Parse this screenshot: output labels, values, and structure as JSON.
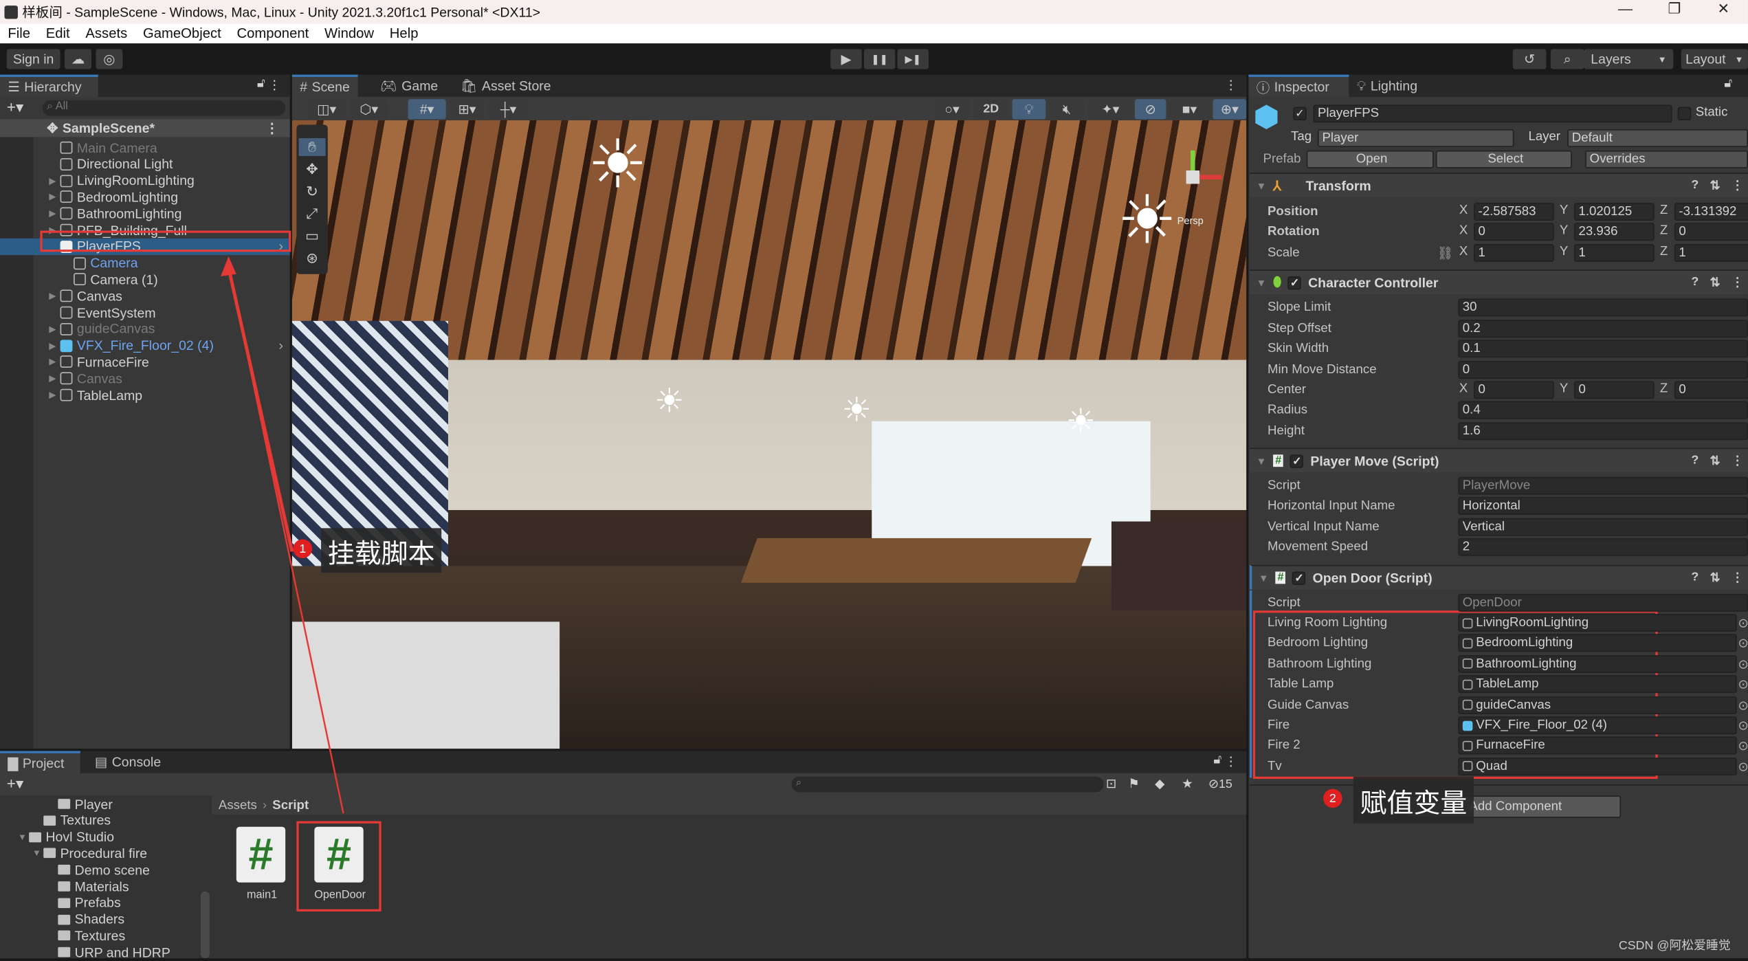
{
  "window": {
    "title": "样板间 - SampleScene - Windows, Mac, Linux - Unity 2021.3.20f1c1 Personal* <DX11>",
    "controls": [
      "—",
      "❐",
      "✕"
    ]
  },
  "menu": [
    "File",
    "Edit",
    "Assets",
    "GameObject",
    "Component",
    "Window",
    "Help"
  ],
  "toolbar": {
    "sign_in": "Sign in",
    "play": "▶",
    "pause": "❚❚",
    "step": "▶❚",
    "layers": "Layers",
    "layout": "Layout"
  },
  "hierarchy": {
    "tab": "Hierarchy",
    "search_placeholder": "All",
    "scene": "SampleScene*",
    "items": [
      {
        "label": "Main Camera",
        "state": "disabled"
      },
      {
        "label": "Directional Light"
      },
      {
        "label": "LivingRoomLighting",
        "expandable": true
      },
      {
        "label": "BedroomLighting",
        "expandable": true
      },
      {
        "label": "BathroomLighting",
        "expandable": true
      },
      {
        "label": "PFB_Building_Full",
        "expandable": true
      },
      {
        "label": "PlayerFPS",
        "selected": true,
        "prefab": true
      },
      {
        "label": "Camera",
        "child": true,
        "color": "blue"
      },
      {
        "label": "Camera (1)",
        "child": true
      },
      {
        "label": "Canvas",
        "expandable": true
      },
      {
        "label": "EventSystem"
      },
      {
        "label": "guideCanvas",
        "expandable": true,
        "state": "disabled"
      },
      {
        "label": "VFX_Fire_Floor_02 (4)",
        "expandable": true,
        "prefab": true,
        "color": "blue"
      },
      {
        "label": "FurnaceFire",
        "expandable": true
      },
      {
        "label": "Canvas",
        "expandable": true,
        "state": "disabled"
      },
      {
        "label": "TableLamp",
        "expandable": true
      }
    ]
  },
  "scene_view": {
    "tabs": [
      "Scene",
      "Game",
      "Asset Store"
    ],
    "mode_2d": "2D",
    "persp": "Persp"
  },
  "inspector": {
    "tabs": [
      "Inspector",
      "Lighting"
    ],
    "object_name": "PlayerFPS",
    "static": "Static",
    "tag_label": "Tag",
    "tag": "Player",
    "layer_label": "Layer",
    "layer": "Default",
    "prefab_label": "Prefab",
    "open": "Open",
    "select": "Select",
    "overrides": "Overrides",
    "transform": {
      "title": "Transform",
      "position": {
        "label": "Position",
        "x": "-2.587583",
        "y": "1.020125",
        "z": "-3.131392"
      },
      "rotation": {
        "label": "Rotation",
        "x": "0",
        "y": "23.936",
        "z": "0"
      },
      "scale": {
        "label": "Scale",
        "x": "1",
        "y": "1",
        "z": "1"
      }
    },
    "character_controller": {
      "title": "Character Controller",
      "fields": [
        {
          "label": "Slope Limit",
          "value": "30"
        },
        {
          "label": "Step Offset",
          "value": "0.2"
        },
        {
          "label": "Skin Width",
          "value": "0.1"
        },
        {
          "label": "Min Move Distance",
          "value": "0"
        }
      ],
      "center": {
        "label": "Center",
        "x": "0",
        "y": "0",
        "z": "0"
      },
      "radius": {
        "label": "Radius",
        "value": "0.4"
      },
      "height": {
        "label": "Height",
        "value": "1.6"
      }
    },
    "player_move": {
      "title": "Player Move (Script)",
      "script_label": "Script",
      "script": "PlayerMove",
      "fields": [
        {
          "label": "Horizontal Input Name",
          "value": "Horizontal"
        },
        {
          "label": "Vertical Input Name",
          "value": "Vertical"
        },
        {
          "label": "Movement Speed",
          "value": "2"
        }
      ]
    },
    "open_door": {
      "title": "Open Door (Script)",
      "script_label": "Script",
      "script": "OpenDoor",
      "fields": [
        {
          "label": "Living Room Lighting",
          "value": "LivingRoomLighting"
        },
        {
          "label": "Bedroom Lighting",
          "value": "BedroomLighting"
        },
        {
          "label": "Bathroom Lighting",
          "value": "BathroomLighting"
        },
        {
          "label": "Table Lamp",
          "value": "TableLamp"
        },
        {
          "label": "Guide Canvas",
          "value": "guideCanvas"
        },
        {
          "label": "Fire",
          "value": "VFX_Fire_Floor_02 (4)"
        },
        {
          "label": "Fire 2",
          "value": "FurnaceFire"
        },
        {
          "label": "Tv",
          "value": "Quad"
        }
      ]
    },
    "add_component": "Add Component"
  },
  "project": {
    "tabs": [
      "Project",
      "Console"
    ],
    "hidden_count": "15",
    "tree": [
      {
        "label": "Player",
        "indent": 2
      },
      {
        "label": "Textures",
        "indent": 1
      },
      {
        "label": "Hovl Studio",
        "indent": 0,
        "open": true
      },
      {
        "label": "Procedural fire",
        "indent": 1,
        "open": true
      },
      {
        "label": "Demo scene",
        "indent": 2
      },
      {
        "label": "Materials",
        "indent": 2
      },
      {
        "label": "Prefabs",
        "indent": 2
      },
      {
        "label": "Shaders",
        "indent": 2
      },
      {
        "label": "Textures",
        "indent": 2
      },
      {
        "label": "URP and HDRP",
        "indent": 2
      }
    ],
    "breadcrumb": [
      "Assets",
      "Script"
    ],
    "assets": [
      {
        "label": "main1"
      },
      {
        "label": "OpenDoor"
      }
    ]
  },
  "annotations": [
    {
      "number": "1",
      "text": "挂载脚本"
    },
    {
      "number": "2",
      "text": "赋值变量"
    }
  ],
  "watermark": "CSDN @阿松爱睡觉"
}
